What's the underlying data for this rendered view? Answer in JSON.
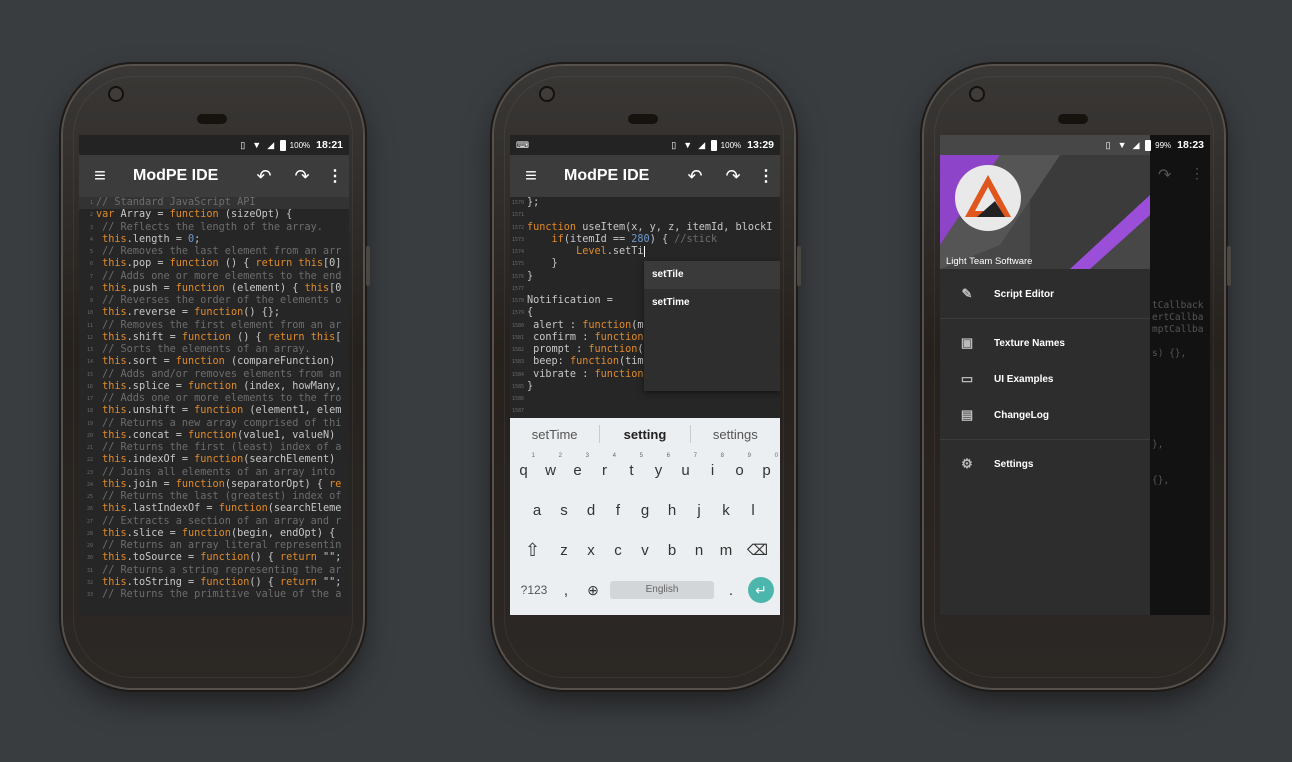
{
  "phone1": {
    "status": {
      "battery": "100%",
      "time": "18:21"
    },
    "title": "ModPE IDE",
    "icons": {
      "menu": "menu-icon",
      "undo": "undo-icon",
      "redo": "redo-icon",
      "more": "more-vert-icon"
    },
    "lines": [
      {
        "n": "1",
        "t": [
          [
            "c",
            "// Standard JavaScript API"
          ]
        ],
        "hl": true
      },
      {
        "n": "2",
        "t": [
          [
            "k",
            "var"
          ],
          [
            "t",
            " Array = "
          ],
          [
            "k",
            "function"
          ],
          [
            "t",
            " (sizeOpt) {"
          ]
        ]
      },
      {
        "n": "3",
        "t": [
          [
            "c",
            " // Reflects the length of the array."
          ]
        ]
      },
      {
        "n": "4",
        "t": [
          [
            "k",
            " this"
          ],
          [
            "t",
            ".length = "
          ],
          [
            "n",
            "0"
          ],
          [
            "t",
            ";"
          ]
        ]
      },
      {
        "n": "5",
        "t": [
          [
            "c",
            " // Removes the last element from an arr"
          ]
        ]
      },
      {
        "n": "6",
        "t": [
          [
            "k",
            " this"
          ],
          [
            "t",
            ".pop = "
          ],
          [
            "k",
            "function"
          ],
          [
            "t",
            " () { "
          ],
          [
            "k",
            "return this"
          ],
          [
            "t",
            "[0]"
          ]
        ]
      },
      {
        "n": "7",
        "t": [
          [
            "c",
            " // Adds one or more elements to the end"
          ]
        ]
      },
      {
        "n": "8",
        "t": [
          [
            "k",
            " this"
          ],
          [
            "t",
            ".push = "
          ],
          [
            "k",
            "function"
          ],
          [
            "t",
            " (element) { "
          ],
          [
            "k",
            "this"
          ],
          [
            "t",
            "[0"
          ]
        ]
      },
      {
        "n": "9",
        "t": [
          [
            "c",
            " // Reverses the order of the elements o"
          ]
        ]
      },
      {
        "n": "10",
        "t": [
          [
            "k",
            " this"
          ],
          [
            "t",
            ".reverse = "
          ],
          [
            "k",
            "function"
          ],
          [
            "t",
            "() {};"
          ]
        ]
      },
      {
        "n": "11",
        "t": [
          [
            "c",
            " // Removes the first element from an ar"
          ]
        ]
      },
      {
        "n": "12",
        "t": [
          [
            "k",
            " this"
          ],
          [
            "t",
            ".shift = "
          ],
          [
            "k",
            "function"
          ],
          [
            "t",
            " () { "
          ],
          [
            "k",
            "return this"
          ],
          [
            "t",
            "["
          ]
        ]
      },
      {
        "n": "13",
        "t": [
          [
            "c",
            " // Sorts the elements of an array."
          ]
        ]
      },
      {
        "n": "14",
        "t": [
          [
            "k",
            " this"
          ],
          [
            "t",
            ".sort = "
          ],
          [
            "k",
            "function"
          ],
          [
            "t",
            " (compareFunction)"
          ]
        ]
      },
      {
        "n": "15",
        "t": [
          [
            "c",
            " // Adds and/or removes elements from an"
          ]
        ]
      },
      {
        "n": "16",
        "t": [
          [
            "k",
            " this"
          ],
          [
            "t",
            ".splice = "
          ],
          [
            "k",
            "function"
          ],
          [
            "t",
            " (index, howMany,"
          ]
        ]
      },
      {
        "n": "17",
        "t": [
          [
            "c",
            " // Adds one or more elements to the fro"
          ]
        ]
      },
      {
        "n": "18",
        "t": [
          [
            "k",
            " this"
          ],
          [
            "t",
            ".unshift = "
          ],
          [
            "k",
            "function"
          ],
          [
            "t",
            " (element1, elem"
          ]
        ]
      },
      {
        "n": "19",
        "t": [
          [
            "c",
            " // Returns a new array comprised of thi"
          ]
        ]
      },
      {
        "n": "20",
        "t": [
          [
            "k",
            " this"
          ],
          [
            "t",
            ".concat = "
          ],
          [
            "k",
            "function"
          ],
          [
            "t",
            "(value1, valueN)"
          ]
        ]
      },
      {
        "n": "21",
        "t": [
          [
            "c",
            " // Returns the first (least) index of a"
          ]
        ]
      },
      {
        "n": "22",
        "t": [
          [
            "k",
            " this"
          ],
          [
            "t",
            ".indexOf = "
          ],
          [
            "k",
            "function"
          ],
          [
            "t",
            "(searchElement)"
          ]
        ]
      },
      {
        "n": "23",
        "t": [
          [
            "c",
            " // Joins all elements of an array into"
          ]
        ]
      },
      {
        "n": "24",
        "t": [
          [
            "k",
            " this"
          ],
          [
            "t",
            ".join = "
          ],
          [
            "k",
            "function"
          ],
          [
            "t",
            "(separatorOpt) { "
          ],
          [
            "k",
            "re"
          ]
        ]
      },
      {
        "n": "25",
        "t": [
          [
            "c",
            " // Returns the last (greatest) index of"
          ]
        ]
      },
      {
        "n": "26",
        "t": [
          [
            "k",
            " this"
          ],
          [
            "t",
            ".lastIndexOf = "
          ],
          [
            "k",
            "function"
          ],
          [
            "t",
            "(searchEleme"
          ]
        ]
      },
      {
        "n": "27",
        "t": [
          [
            "c",
            " // Extracts a section of an array and r"
          ]
        ]
      },
      {
        "n": "28",
        "t": [
          [
            "k",
            " this"
          ],
          [
            "t",
            ".slice = "
          ],
          [
            "k",
            "function"
          ],
          [
            "t",
            "(begin, endOpt) {"
          ]
        ]
      },
      {
        "n": "29",
        "t": [
          [
            "c",
            " // Returns an array literal representin"
          ]
        ]
      },
      {
        "n": "30",
        "t": [
          [
            "k",
            " this"
          ],
          [
            "t",
            ".toSource = "
          ],
          [
            "k",
            "function"
          ],
          [
            "t",
            "() { "
          ],
          [
            "k",
            "return"
          ],
          [
            "t",
            " \"\";"
          ]
        ]
      },
      {
        "n": "31",
        "t": [
          [
            "c",
            " // Returns a string representing the ar"
          ]
        ]
      },
      {
        "n": "32",
        "t": [
          [
            "k",
            " this"
          ],
          [
            "t",
            ".toString = "
          ],
          [
            "k",
            "function"
          ],
          [
            "t",
            "() { "
          ],
          [
            "k",
            "return"
          ],
          [
            "t",
            " \"\";"
          ]
        ]
      },
      {
        "n": "33",
        "t": [
          [
            "c",
            " // Returns the primitive value of the a"
          ]
        ]
      }
    ]
  },
  "phone2": {
    "status": {
      "battery": "100%",
      "time": "13:29"
    },
    "title": "ModPE IDE",
    "icons": {
      "menu": "menu-icon",
      "undo": "undo-icon",
      "redo": "redo-icon",
      "more": "more-vert-icon"
    },
    "lines": [
      {
        "n": "1570",
        "t": [
          [
            "t",
            "};"
          ]
        ]
      },
      {
        "n": "1571",
        "t": []
      },
      {
        "n": "1572",
        "t": [
          [
            "k",
            "function"
          ],
          [
            "t",
            " useItem(x, y, z, itemId, blockI"
          ]
        ]
      },
      {
        "n": "1573",
        "t": [
          [
            "k",
            "    if"
          ],
          [
            "t",
            "(itemId == "
          ],
          [
            "n",
            "280"
          ],
          [
            "t",
            ") { "
          ],
          [
            "c",
            "//stick"
          ]
        ]
      },
      {
        "n": "1574",
        "t": [
          [
            "k",
            "        Level"
          ],
          [
            "t",
            ".setTi"
          ]
        ]
      },
      {
        "n": "1575",
        "t": [
          [
            "t",
            "    }"
          ]
        ]
      },
      {
        "n": "1576",
        "t": [
          [
            "t",
            "}"
          ]
        ]
      },
      {
        "n": "1577",
        "t": []
      },
      {
        "n": "1578",
        "t": [
          [
            "t",
            "Notification ="
          ]
        ]
      },
      {
        "n": "1579",
        "t": [
          [
            "t",
            "{"
          ]
        ]
      },
      {
        "n": "1580",
        "t": [
          [
            "t",
            " alert : "
          ],
          [
            "k",
            "function"
          ],
          [
            "t",
            "(m"
          ]
        ]
      },
      {
        "n": "1581",
        "t": [
          [
            "t",
            " confirm : "
          ],
          [
            "k",
            "function"
          ]
        ]
      },
      {
        "n": "1582",
        "t": [
          [
            "t",
            " prompt : "
          ],
          [
            "k",
            "function"
          ],
          [
            "t",
            "("
          ]
        ]
      },
      {
        "n": "1583",
        "t": [
          [
            "t",
            " beep: "
          ],
          [
            "k",
            "function"
          ],
          [
            "t",
            "(tim"
          ]
        ]
      },
      {
        "n": "1584",
        "t": [
          [
            "t",
            " vibrate : "
          ],
          [
            "k",
            "function"
          ]
        ]
      },
      {
        "n": "1585",
        "t": [
          [
            "t",
            "}"
          ]
        ]
      },
      {
        "n": "1586",
        "t": []
      },
      {
        "n": "1587",
        "t": []
      }
    ],
    "autocomplete": [
      "setTile",
      "setTime"
    ],
    "keyboard": {
      "suggestions": [
        "setTime",
        "setting",
        "settings"
      ],
      "row1": [
        "q",
        "w",
        "e",
        "r",
        "t",
        "y",
        "u",
        "i",
        "o",
        "p"
      ],
      "row1_digits": [
        "1",
        "2",
        "3",
        "4",
        "5",
        "6",
        "7",
        "8",
        "9",
        "0"
      ],
      "row2": [
        "a",
        "s",
        "d",
        "f",
        "g",
        "h",
        "j",
        "k",
        "l"
      ],
      "row3": [
        "z",
        "x",
        "c",
        "v",
        "b",
        "n",
        "m"
      ],
      "symbols": "?123",
      "comma": ",",
      "space": "English",
      "period": ".",
      "shift_icon": "shift-icon",
      "backspace_icon": "backspace-icon",
      "globe_icon": "globe-icon",
      "enter_icon": "enter-icon"
    }
  },
  "phone3": {
    "status": {
      "battery": "99%",
      "time": "18:23"
    },
    "company": "Light Team Software",
    "menu": [
      {
        "label": "Script Editor",
        "icon": "pencil-icon"
      },
      {
        "label": "Texture Names",
        "icon": "image-icon"
      },
      {
        "label": "UI Examples",
        "icon": "window-icon"
      },
      {
        "label": "ChangeLog",
        "icon": "clipboard-icon"
      },
      {
        "label": "Settings",
        "icon": "gear-icon"
      }
    ]
  }
}
